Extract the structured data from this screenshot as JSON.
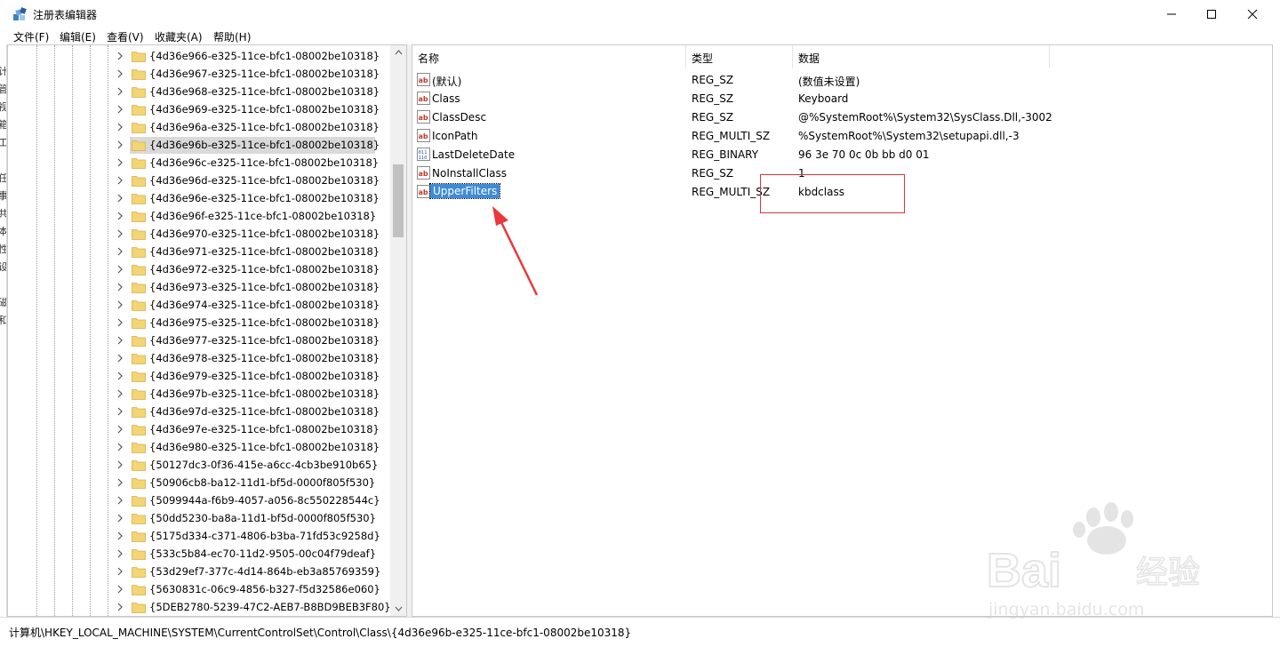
{
  "window": {
    "title": "注册表编辑器",
    "controls": [
      "minimize",
      "maximize",
      "close"
    ]
  },
  "menu": {
    "items": [
      "文件(F)",
      "编辑(E)",
      "查看(V)",
      "收藏夹(A)",
      "帮助(H)"
    ]
  },
  "left_strip_glyphs": [
    "计",
    "管",
    "视",
    "箱",
    "工",
    "任",
    "事",
    "共",
    "本",
    "性",
    "设",
    "磁",
    "和"
  ],
  "tree": {
    "selected_index": 5,
    "items": [
      "{4d36e966-e325-11ce-bfc1-08002be10318}",
      "{4d36e967-e325-11ce-bfc1-08002be10318}",
      "{4d36e968-e325-11ce-bfc1-08002be10318}",
      "{4d36e969-e325-11ce-bfc1-08002be10318}",
      "{4d36e96a-e325-11ce-bfc1-08002be10318}",
      "{4d36e96b-e325-11ce-bfc1-08002be10318}",
      "{4d36e96c-e325-11ce-bfc1-08002be10318}",
      "{4d36e96d-e325-11ce-bfc1-08002be10318}",
      "{4d36e96e-e325-11ce-bfc1-08002be10318}",
      "{4d36e96f-e325-11ce-bfc1-08002be10318}",
      "{4d36e970-e325-11ce-bfc1-08002be10318}",
      "{4d36e971-e325-11ce-bfc1-08002be10318}",
      "{4d36e972-e325-11ce-bfc1-08002be10318}",
      "{4d36e973-e325-11ce-bfc1-08002be10318}",
      "{4d36e974-e325-11ce-bfc1-08002be10318}",
      "{4d36e975-e325-11ce-bfc1-08002be10318}",
      "{4d36e977-e325-11ce-bfc1-08002be10318}",
      "{4d36e978-e325-11ce-bfc1-08002be10318}",
      "{4d36e979-e325-11ce-bfc1-08002be10318}",
      "{4d36e97b-e325-11ce-bfc1-08002be10318}",
      "{4d36e97d-e325-11ce-bfc1-08002be10318}",
      "{4d36e97e-e325-11ce-bfc1-08002be10318}",
      "{4d36e980-e325-11ce-bfc1-08002be10318}",
      "{50127dc3-0f36-415e-a6cc-4cb3be910b65}",
      "{50906cb8-ba12-11d1-bf5d-0000f805f530}",
      "{5099944a-f6b9-4057-a056-8c550228544c}",
      "{50dd5230-ba8a-11d1-bf5d-0000f805f530}",
      "{5175d334-c371-4806-b3ba-71fd53c9258d}",
      "{533c5b84-ec70-11d2-9505-00c04f79deaf}",
      "{53d29ef7-377c-4d14-864b-eb3a85769359}",
      "{5630831c-06c9-4856-b327-f5d32586e060}",
      "{5DEB2780-5239-47C2-AEB7-B8BD9BEB3F80}"
    ]
  },
  "list": {
    "columns": {
      "name": "名称",
      "type": "类型",
      "data": "数据"
    },
    "selected_index": 6,
    "rows": [
      {
        "name": "(默认)",
        "type": "REG_SZ",
        "data": "(数值未设置)",
        "icon": "string-value-icon"
      },
      {
        "name": "Class",
        "type": "REG_SZ",
        "data": "Keyboard",
        "icon": "string-value-icon"
      },
      {
        "name": "ClassDesc",
        "type": "REG_SZ",
        "data": "@%SystemRoot%\\System32\\SysClass.Dll,-3002",
        "icon": "string-value-icon"
      },
      {
        "name": "IconPath",
        "type": "REG_MULTI_SZ",
        "data": "%SystemRoot%\\System32\\setupapi.dll,-3",
        "icon": "string-value-icon"
      },
      {
        "name": "LastDeleteDate",
        "type": "REG_BINARY",
        "data": "96 3e 70 0c 0b bb d0 01",
        "icon": "binary-value-icon"
      },
      {
        "name": "NoInstallClass",
        "type": "REG_SZ",
        "data": "1",
        "icon": "string-value-icon"
      },
      {
        "name": "UpperFilters",
        "type": "REG_MULTI_SZ",
        "data": "kbdclass",
        "icon": "string-value-icon"
      }
    ]
  },
  "status": {
    "path": "计算机\\HKEY_LOCAL_MACHINE\\SYSTEM\\CurrentControlSet\\Control\\Class\\{4d36e96b-e325-11ce-bfc1-08002be10318}"
  },
  "watermark": {
    "brand": "Bai",
    "brand_cn": "经验",
    "url": "jingyan.baidu.com"
  },
  "colors": {
    "selection_blue": "#3f8bd5",
    "tree_selected_gray": "#d9d9d9",
    "folder_yellow": "#f3d575",
    "annotation_red": "#d9363e"
  }
}
